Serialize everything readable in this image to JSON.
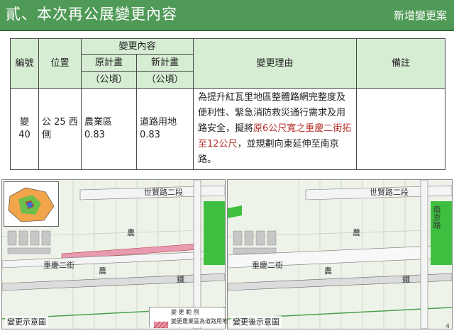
{
  "header": {
    "title": "貳、本次再公展變更內容",
    "tag": "新增變更案"
  },
  "table": {
    "headers": {
      "no": "編號",
      "location": "位置",
      "change_content": "變更內容",
      "original": "原計畫",
      "original_unit": "（公頃）",
      "new": "新計畫",
      "new_unit": "（公頃）",
      "reason": "變更理由",
      "remark": "備註"
    },
    "row": {
      "no_1": "變",
      "no_2": "40",
      "location_1": "公 25 西",
      "location_2": "側",
      "original_name": "農業區",
      "original_value": "0.83",
      "new_name": "道路用地",
      "new_value": "0.83",
      "reason_1": "為提升紅瓦里地區整體路網完整度及便利性、緊急消防救災通行需求及用路安全，擬將",
      "reason_2": "原6公尺寬之重慶二街拓至12公尺",
      "reason_3": "，並規劃向東延伸至南京路。",
      "remark": ""
    }
  },
  "maps": {
    "before": {
      "label": "變更示意圖",
      "roads": {
        "shijian": "世賢路二段",
        "chongqing": "重慶二街",
        "nong1": "農",
        "nong2": "農",
        "tie": "鐵"
      }
    },
    "after": {
      "label": "變更後示意圖",
      "roads": {
        "shijian": "世賢路二段",
        "nanjing": "南京路",
        "chongqing": "重慶二街",
        "nong1": "農",
        "nong2": "農",
        "tie": "鐵"
      },
      "legend_title": "變 更 範 例",
      "legend_text": "變更農業區為道路用地"
    }
  },
  "page_number": "4",
  "colors": {
    "header_bg": "#4f9a57",
    "table_header_bg": "#d6ecd3",
    "highlight_red": "#b5312b",
    "park_green": "#3fbf3f",
    "change_pink": "#e89ab0"
  }
}
